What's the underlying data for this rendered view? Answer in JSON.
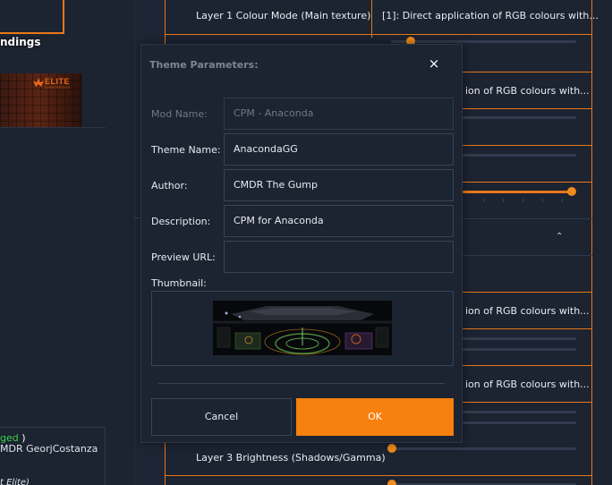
{
  "background": {
    "banner_title": "ndings",
    "logo_text": "ELITE",
    "logo_subtext": "DANGEROUS",
    "news": {
      "line1_green": "ged",
      "line1_rest": " )",
      "line2": "MDR GeorjCostanza",
      "line3": "t Elite)"
    },
    "settings_rows": [
      {
        "label": "Layer 1 Colour Mode (Main texture)",
        "value": "[1]: Direct application of RGB colours with..."
      }
    ],
    "partial_values": [
      "ion of RGB colours with...",
      "ion of RGB colours with...",
      "ion of RGB colours with..."
    ],
    "bottom_row_label": "Layer 3 Brightness (Shadows/Gamma)",
    "accent_color": "#e8771a"
  },
  "dialog": {
    "title": "Theme Parameters:",
    "close_label": "×",
    "fields": {
      "mod_name": {
        "label": "Mod Name:",
        "value": "CPM - Anaconda"
      },
      "theme_name": {
        "label": "Theme Name:",
        "value": "AnacondaGG"
      },
      "author": {
        "label": "Author:",
        "value": "CMDR The Gump"
      },
      "description": {
        "label": "Description:",
        "value": "CPM for Anaconda"
      },
      "preview_url": {
        "label": "Preview URL:",
        "value": ""
      }
    },
    "thumbnail_label": "Thumbnail:",
    "cancel_label": "Cancel",
    "ok_label": "OK",
    "ok_color": "#f7800f"
  }
}
